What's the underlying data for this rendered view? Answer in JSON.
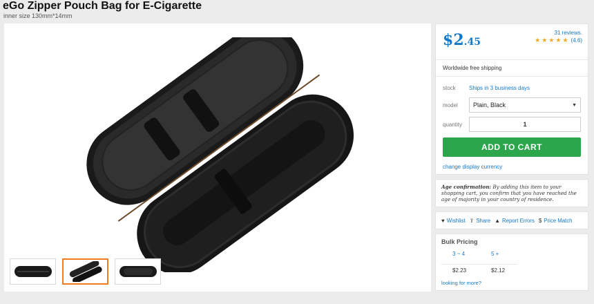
{
  "product": {
    "title": "eGo Zipper Pouch Bag for E-Cigarette",
    "subtitle": "inner size 130mm*14mm"
  },
  "price": {
    "currency": "$",
    "whole": "2",
    "cents": ".45"
  },
  "reviews": {
    "link": "31 reviews.",
    "rating": "(4.6)",
    "stars": 4.6
  },
  "shipping": "Worldwide free shipping",
  "options": {
    "stock_label": "stock",
    "stock_value": "Ships in 3 business days",
    "model_label": "model",
    "model_value": "Plain, Black",
    "quantity_label": "quantity",
    "quantity_value": "1",
    "add_to_cart": "ADD TO CART",
    "change_currency": "change display currency"
  },
  "age": {
    "heading": "Age confirmation:",
    "text": "By adding this item to your shopping cart, you confirm that you have reached the age of majority in your country of residence."
  },
  "actions": {
    "wishlist": "Wishlist",
    "share": "Share",
    "report": "Report Errors",
    "price_match": "Price Match"
  },
  "bulk": {
    "title": "Bulk Pricing",
    "headers": [
      "3 ~ 4",
      "5 +"
    ],
    "prices": [
      "$2.23",
      "$2.12"
    ],
    "more": "looking for more?"
  },
  "colors": {
    "accent": "#1478c8",
    "cart": "#2da54a",
    "thumb_active": "#f07c22"
  }
}
